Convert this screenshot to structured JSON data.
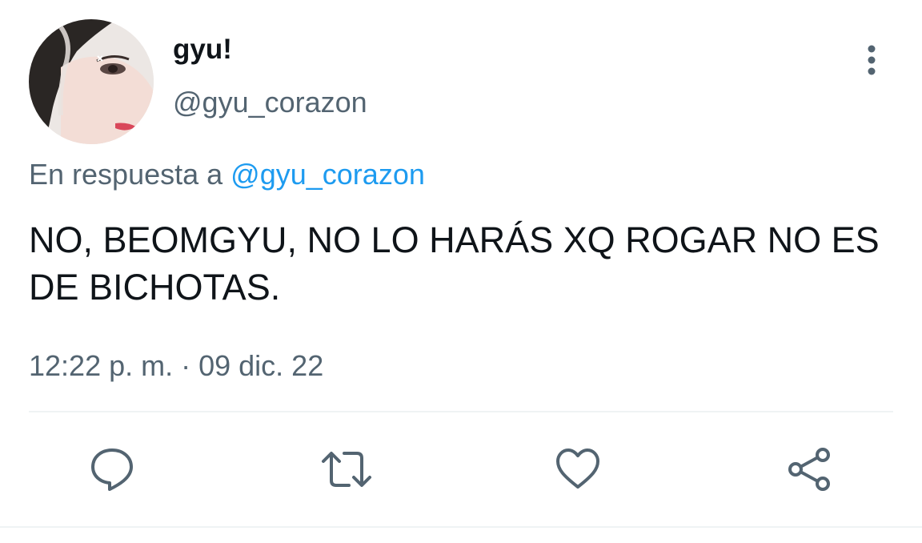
{
  "author": {
    "display_name": "gyu!",
    "handle": "@gyu_corazon"
  },
  "reply_context": {
    "prefix": "En respuesta a",
    "mention": "@gyu_corazon"
  },
  "tweet": {
    "text": "NO, BEOMGYU, NO LO HARÁS XQ ROGAR NO ES DE BICHOTAS.",
    "timestamp": "12:22 p. m. · 09 dic. 22"
  },
  "actions": {
    "reply_icon": "speech-bubble-icon",
    "retweet_icon": "retweet-arrows-icon",
    "like_icon": "heart-icon",
    "share_icon": "share-nodes-icon"
  },
  "colors": {
    "text_primary": "#0f1419",
    "text_secondary": "#536471",
    "accent": "#1d9bf0",
    "divider": "#eff3f4"
  }
}
